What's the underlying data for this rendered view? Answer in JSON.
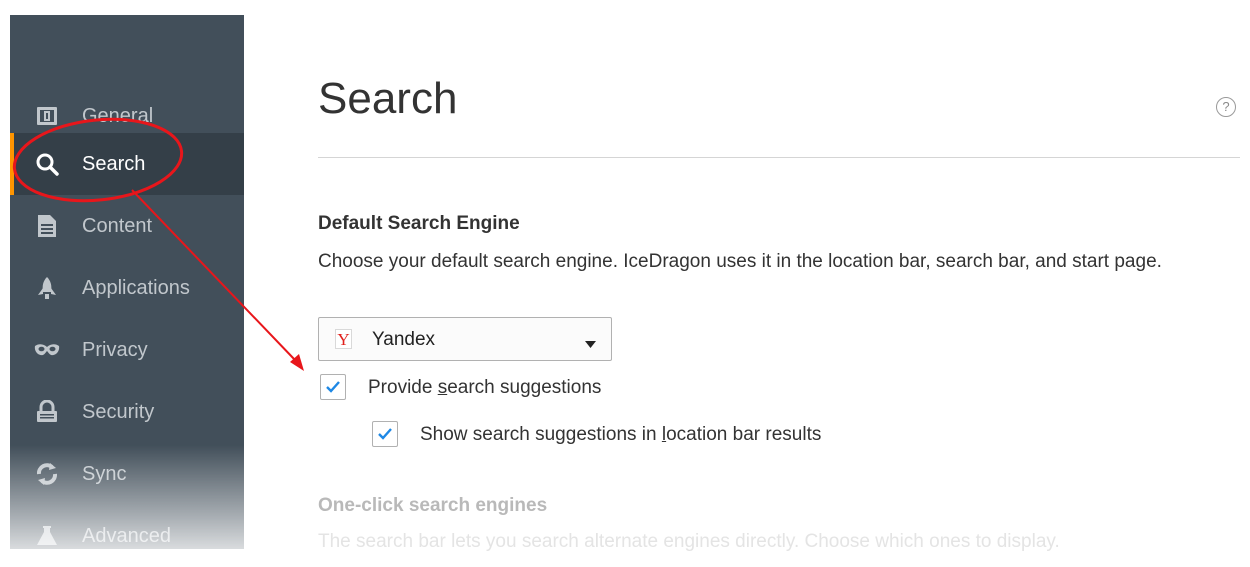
{
  "sidebar": {
    "items": [
      {
        "label": "General",
        "icon": "general-icon",
        "active": false
      },
      {
        "label": "Search",
        "icon": "search-icon",
        "active": true
      },
      {
        "label": "Content",
        "icon": "content-icon",
        "active": false
      },
      {
        "label": "Applications",
        "icon": "applications-icon",
        "active": false
      },
      {
        "label": "Privacy",
        "icon": "privacy-icon",
        "active": false
      },
      {
        "label": "Security",
        "icon": "security-icon",
        "active": false
      },
      {
        "label": "Sync",
        "icon": "sync-icon",
        "active": false
      },
      {
        "label": "Advanced",
        "icon": "advanced-icon",
        "active": false
      }
    ],
    "accent_color": "#ff9500",
    "background": "#424f5a"
  },
  "main": {
    "title": "Search",
    "help_symbol": "?",
    "default_engine": {
      "heading": "Default Search Engine",
      "description": "Choose your default search engine. IceDragon uses it in the location bar, search bar, and start page.",
      "selected": "Yandex",
      "selected_icon": "yandex-icon"
    },
    "suggestions": {
      "provide_pre": "Provide ",
      "provide_access": "s",
      "provide_post": "earch suggestions",
      "provide_checked": true,
      "location_pre": "Show search suggestions in ",
      "location_access": "l",
      "location_post": "ocation bar results",
      "location_checked": true
    },
    "one_click": {
      "heading": "One-click search engines",
      "description": "The search bar lets you search alternate engines directly. Choose which ones to display."
    }
  },
  "annotation": {
    "color": "#e8161b"
  }
}
